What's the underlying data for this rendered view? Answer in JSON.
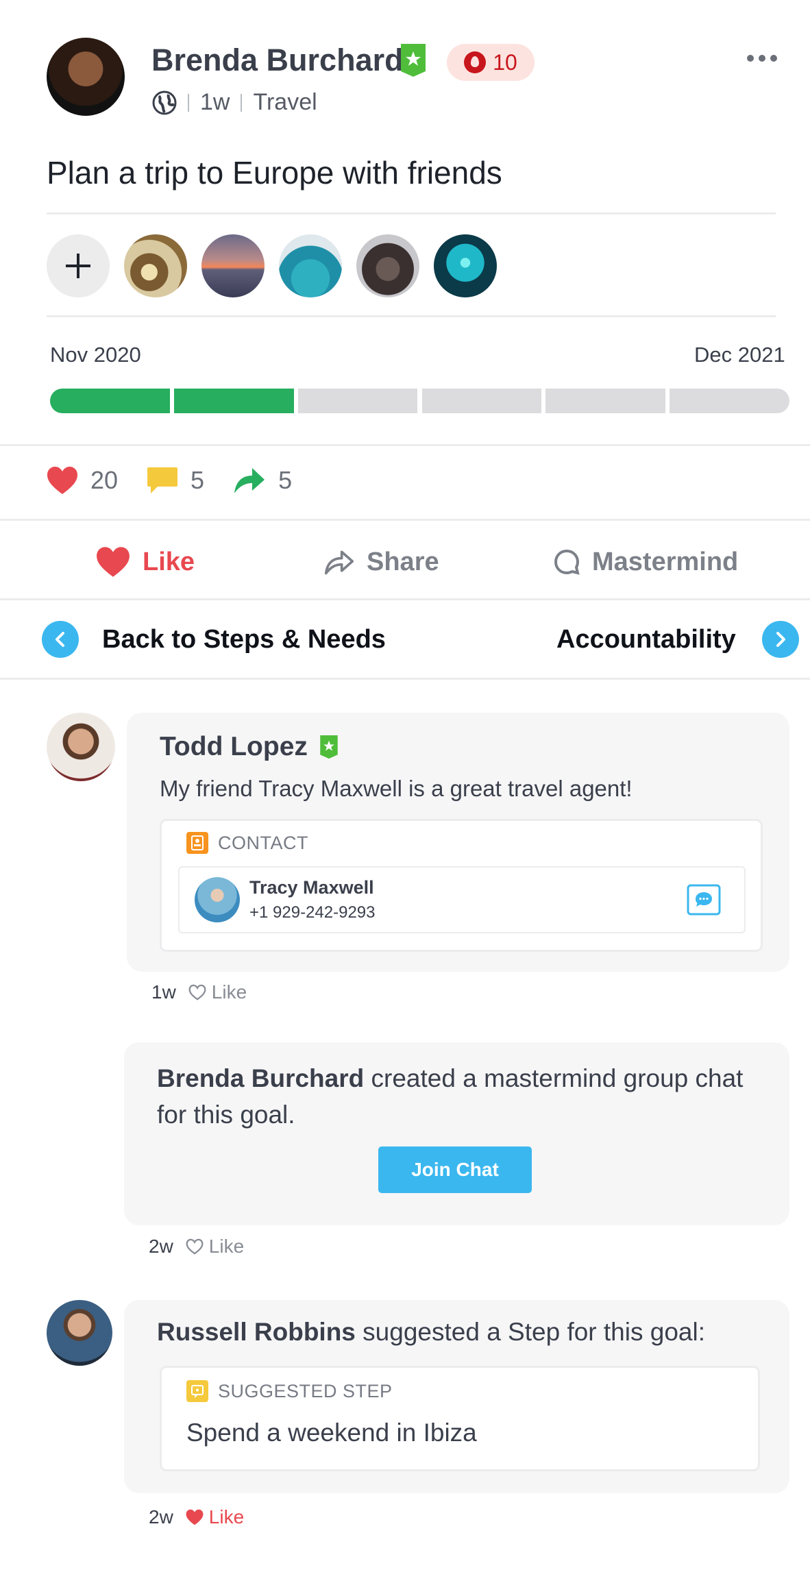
{
  "post": {
    "author": "Brenda Burchard",
    "streak": "10",
    "age": "1w",
    "category": "Travel",
    "goal_title": "Plan a trip to Europe with friends"
  },
  "timeline": {
    "start_label": "Nov 2020",
    "end_label": "Dec 2021",
    "segments_total": 6,
    "segments_complete": 2,
    "complete_color": "#27ae5f",
    "incomplete_color": "#dcdcde"
  },
  "stats": {
    "likes": "20",
    "comments": "5",
    "shares": "5"
  },
  "actions": {
    "like": "Like",
    "share": "Share",
    "mastermind": "Mastermind"
  },
  "nav": {
    "back": "Back to Steps & Needs",
    "next": "Accountability"
  },
  "comments": [
    {
      "author": "Todd Lopez",
      "text": "My friend Tracy Maxwell is a great travel agent!",
      "attachment_label": "CONTACT",
      "contact_name": "Tracy Maxwell",
      "contact_phone": "+1 929-242-9293",
      "age": "1w",
      "like": "Like"
    },
    {
      "author": "Brenda Burchard",
      "text": " created a mastermind group chat for this goal.",
      "button": "Join Chat",
      "age": "2w",
      "like": "Like"
    },
    {
      "author": "Russell Robbins",
      "text": " suggested a Step for this goal:",
      "attachment_label": "SUGGESTED STEP",
      "step_text": "Spend a weekend in Ibiza",
      "age": "2w",
      "like": "Like"
    }
  ],
  "colors": {
    "accent_blue": "#3bb7ef",
    "like_red": "#e8484f",
    "share_green": "#27ae5f",
    "comment_yellow": "#f5c93c",
    "streak_red": "#c8161d"
  }
}
